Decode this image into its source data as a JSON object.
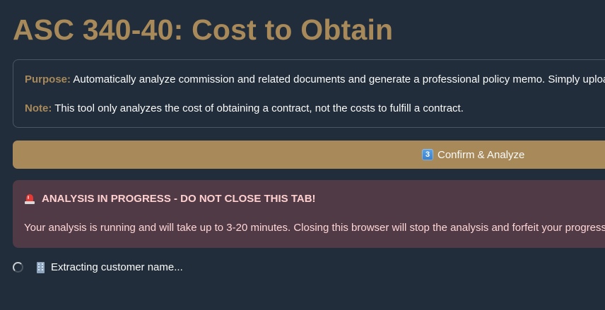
{
  "page": {
    "title": "ASC 340-40: Cost to Obtain"
  },
  "info": {
    "purpose_label": "Purpose:",
    "purpose_text": " Automatically analyze commission and related documents and generate a professional policy memo. Simply upload",
    "note_label": "Note:",
    "note_text": " This tool only analyzes the cost of obtaining a contract, not the costs to fulfill a contract."
  },
  "confirm_button": {
    "icon": "keycap-3-icon",
    "icon_text": "3",
    "label": "Confirm & Analyze"
  },
  "alert": {
    "icon": "siren-icon",
    "heading": "ANALYSIS IN PROGRESS - DO NOT CLOSE THIS TAB!",
    "body": "Your analysis is running and will take up to 3-20 minutes. Closing this browser will stop the analysis and forfeit your progress."
  },
  "status": {
    "spinner_icon": "spinner-icon",
    "icon": "office-building-icon",
    "text": "Extracting customer name..."
  },
  "colors": {
    "background": "#212d3a",
    "accent": "#a8895a",
    "alert_background": "#4f3a45",
    "alert_text": "#ffd0d0"
  }
}
